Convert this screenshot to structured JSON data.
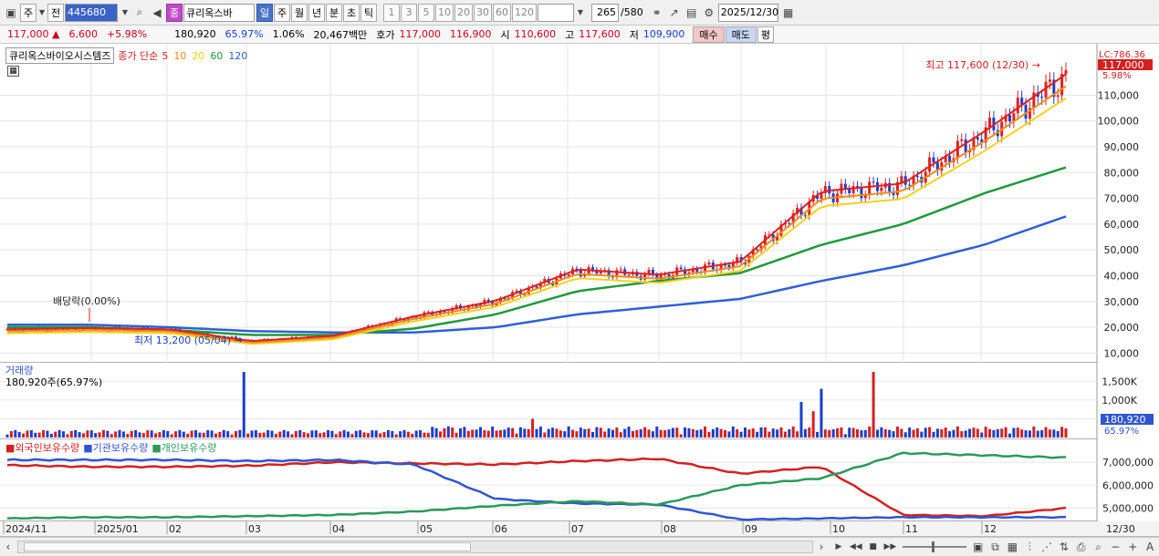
{
  "toolbar": {
    "market_label": "주",
    "prev_label": "전",
    "code": "445680",
    "badge": "종",
    "stock_name": "큐리옥스바",
    "period_tabs": [
      "일",
      "주",
      "월",
      "년",
      "분",
      "초",
      "틱"
    ],
    "active_tab": "일",
    "minute_steps": [
      "1",
      "3",
      "5",
      "10",
      "20",
      "30",
      "60",
      "120"
    ],
    "count": "265",
    "total": "/580",
    "date": "2025/12/30"
  },
  "quote": {
    "price": "117,000",
    "change": "6,600",
    "change_pct": "+5.98%",
    "volume": "180,920",
    "volume_ratio": "65.97%",
    "turnover": "1.06%",
    "amount": "20,467백만",
    "bid_label": "호가",
    "ask": "117,000",
    "bid": "116,900",
    "open_label": "시",
    "open": "110,600",
    "high_label": "고",
    "high": "117,600",
    "low_label": "저",
    "low": "109,900",
    "buy": "매수",
    "sell": "매도",
    "eval": "평"
  },
  "price_panel": {
    "title": "큐리옥스바이오시스템즈",
    "ma_label": "종가 단순",
    "ma_periods": [
      "5",
      "10",
      "20",
      "60",
      "120"
    ],
    "ma_colors": [
      "#e02020",
      "#f08a1c",
      "#f3d31a",
      "#1e9a3a",
      "#2f5fd8"
    ],
    "max_label": "최고 117,600 (12/30)",
    "min_label": "최저 13,200 (05/04)",
    "dividend_label": "배당락(0.00%)",
    "lc_label": "LC:786.36",
    "cur_tag": "117,000",
    "cur_pct": "5.98%",
    "y_ticks": [
      "110,000",
      "100,000",
      "90,000",
      "80,000",
      "70,000",
      "60,000",
      "50,000",
      "40,000",
      "30,000",
      "20,000",
      "10,000"
    ]
  },
  "volume_panel": {
    "title": "거래량",
    "value_label": "180,920주(65.97%)",
    "y_ticks": [
      "1,500K",
      "1,000K",
      "500K"
    ],
    "tag_value": "180,920",
    "tag_pct": "65.97%"
  },
  "holding_panel": {
    "legend": [
      "외국인보유수량",
      "기관보유수량",
      "개인보유수량"
    ],
    "colors": [
      "#d42020",
      "#2f55d0",
      "#2a9a5a"
    ],
    "y_ticks": [
      "7,000,000",
      "6,000,000",
      "5,000,000"
    ]
  },
  "x_axis": {
    "labels": [
      "2024/11",
      "2025/01",
      "02",
      "03",
      "04",
      "05",
      "06",
      "07",
      "08",
      "09",
      "10",
      "11",
      "12"
    ],
    "last_label": "12/30"
  },
  "chart_data": {
    "type": "line",
    "title": "큐리옥스바이오시스템즈",
    "x": [
      "2024/11",
      "2025/01",
      "02",
      "03",
      "04",
      "05",
      "06",
      "07",
      "08",
      "09",
      "10",
      "11",
      "12",
      "12/30"
    ],
    "series": [
      {
        "name": "종가",
        "values": [
          19000,
          19500,
          19000,
          14500,
          16500,
          24000,
          30000,
          42000,
          40000,
          45000,
          72000,
          75000,
          95000,
          117000
        ]
      },
      {
        "name": "60",
        "values": [
          20000,
          20000,
          19000,
          17000,
          17000,
          19500,
          25000,
          34000,
          38000,
          41000,
          52000,
          60000,
          72000,
          82000
        ]
      },
      {
        "name": "120",
        "values": [
          21000,
          21000,
          20000,
          18500,
          18000,
          18000,
          20000,
          25000,
          28000,
          31000,
          38000,
          44000,
          52000,
          63000
        ]
      }
    ],
    "ylim": [
      8000,
      125000
    ],
    "holdings": {
      "외국인보유수량": [
        6870000,
        6800000,
        6800000,
        6850000,
        7000000,
        6950000,
        6900000,
        7050000,
        7150000,
        6500000,
        6800000,
        4700000,
        4650000,
        5000000
      ],
      "기관보유수량": [
        7100000,
        7100000,
        7100000,
        7050000,
        7100000,
        6900000,
        5400000,
        5200000,
        5150000,
        4500000,
        4550000,
        4600000,
        4600000,
        4600000
      ],
      "개인보유수량": [
        4550000,
        4600000,
        4600000,
        4650000,
        4700000,
        4850000,
        5100000,
        5300000,
        5150000,
        6000000,
        6300000,
        7400000,
        7300000,
        7200000
      ]
    }
  }
}
